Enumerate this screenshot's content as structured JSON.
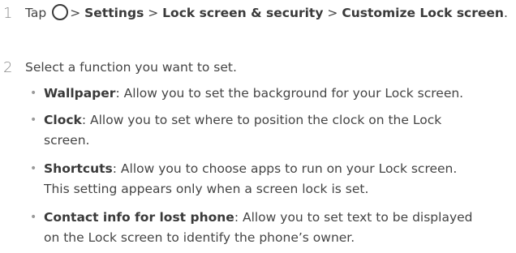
{
  "steps": [
    {
      "number": "1",
      "prefix": "Tap",
      "path": [
        "Settings",
        "Lock screen & security",
        "Customize Lock screen"
      ],
      "suffix": "."
    },
    {
      "number": "2",
      "text": "Select a function you want to set."
    }
  ],
  "separator": ">",
  "bullets": [
    {
      "term": "Wallpaper",
      "line1": ": Allow you to set the background for your Lock screen.",
      "line2": ""
    },
    {
      "term": "Clock",
      "line1": ": Allow you to set where to position the clock on the Lock",
      "line2": "screen."
    },
    {
      "term": "Shortcuts",
      "line1": ": Allow you to choose apps to run on your Lock screen.",
      "line2": "This setting appears only when a screen lock is set."
    },
    {
      "term": "Contact info for lost phone",
      "line1": ": Allow you to set text to be displayed",
      "line2": "on the Lock screen to identify the phone’s owner."
    }
  ]
}
